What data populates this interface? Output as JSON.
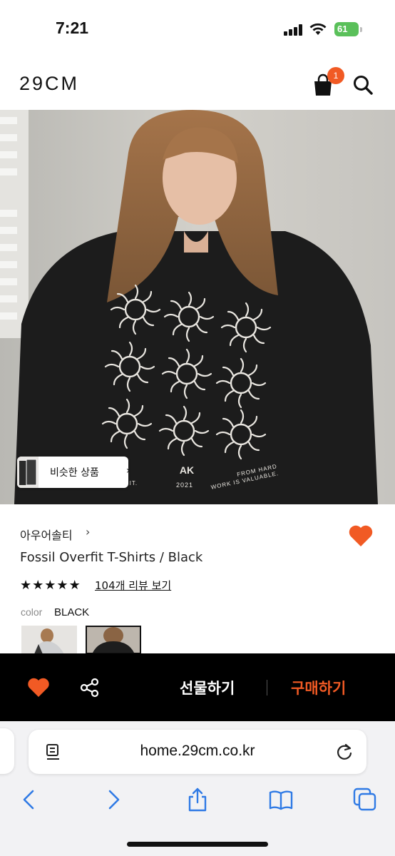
{
  "status_bar": {
    "time": "7:21",
    "battery": "61"
  },
  "header": {
    "logo": "29CM",
    "cart_count": "1"
  },
  "similar_products": {
    "label": "비슷한 상품",
    "chevron": "›"
  },
  "product": {
    "brand": "아우어솔티",
    "brand_chevron": "›",
    "title": "Fossil Overfit T-Shirts / Black",
    "review_link": "104개 리뷰 보기",
    "color_label": "color",
    "color_value": "BLACK",
    "shirt_print": {
      "left": "WITH IT.",
      "year": "2021",
      "right_line1": "FROM HARD",
      "right_line2": "WORK IS VALUABLE."
    }
  },
  "action_bar": {
    "gift_label": "선물하기",
    "buy_label": "구매하기"
  },
  "browser": {
    "url": "home.29cm.co.kr"
  },
  "colors": {
    "accent": "#f15a24",
    "action_bar_bg": "#000000"
  }
}
